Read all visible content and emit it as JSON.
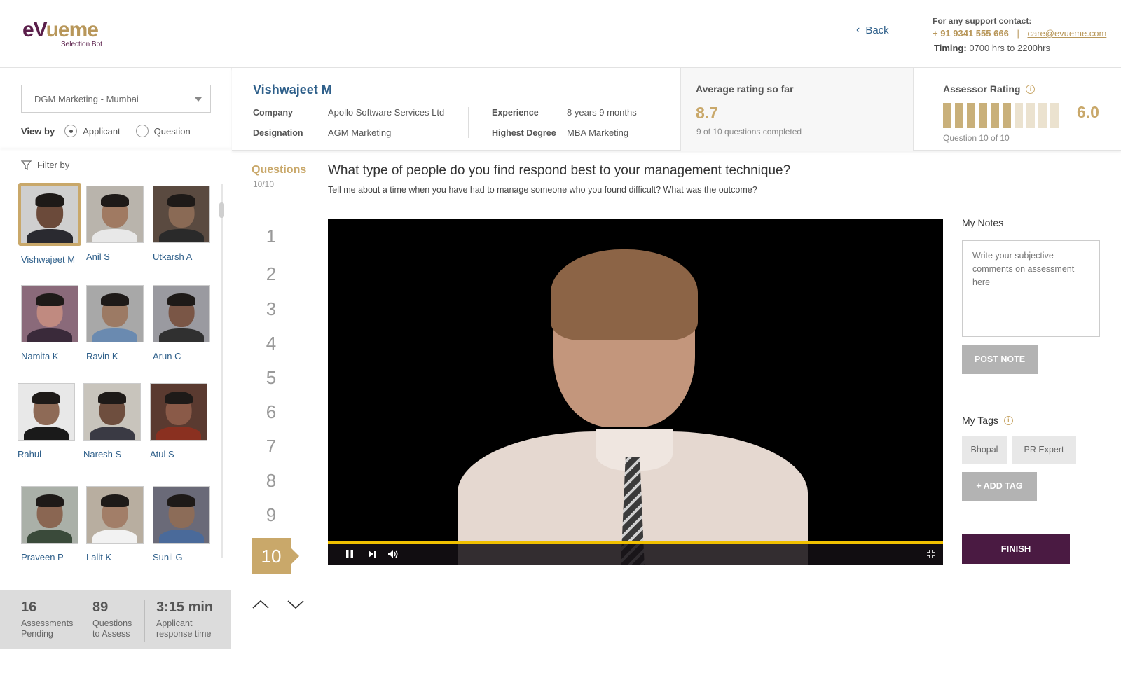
{
  "header": {
    "logo_text_1": "eV",
    "logo_text_2": "ueme",
    "logo_sub": "Selection Bot",
    "back_label": "Back",
    "support_title": "For any support contact:",
    "support_phone": "+ 91 9341 555 666",
    "support_sep": "|",
    "support_email": "care@evueme.com",
    "timing_label": "Timing:",
    "timing_value": "0700 hrs to  2200hrs"
  },
  "left": {
    "select_value": "DGM Marketing - Mumbai",
    "view_by_label": "View by",
    "radio_applicant": "Applicant",
    "radio_question": "Question",
    "filter_label": "Filter by",
    "candidates": [
      {
        "name": "Vishwajeet M",
        "selected": true
      },
      {
        "name": "Anil S"
      },
      {
        "name": "Utkarsh A"
      },
      {
        "name": "Namita K"
      },
      {
        "name": "Ravin K"
      },
      {
        "name": "Arun C"
      },
      {
        "name": "Rahul"
      },
      {
        "name": "Naresh S"
      },
      {
        "name": "Atul S"
      },
      {
        "name": "Praveen P"
      },
      {
        "name": "Lalit K"
      },
      {
        "name": "Sunil G"
      }
    ]
  },
  "stats": [
    {
      "num": "16",
      "l1": "Assessments",
      "l2": "Pending"
    },
    {
      "num": "89",
      "l1": "Questions",
      "l2": "to Assess"
    },
    {
      "num": "3:15 min",
      "l1": "Applicant",
      "l2": "response time"
    }
  ],
  "candidate": {
    "name": "Vishwajeet M",
    "company_label": "Company",
    "company": "Apollo Software Services Ltd",
    "designation_label": "Designation",
    "designation": "AGM Marketing",
    "experience_label": "Experience",
    "experience": "8 years 9 months",
    "degree_label": "Highest Degree",
    "degree": "MBA Marketing"
  },
  "average": {
    "title": "Average rating so far",
    "value": "8.7",
    "sub": "9 of 10 questions completed"
  },
  "assessor": {
    "title": "Assessor Rating",
    "info_icon": "i",
    "value": "6.0",
    "bars_total": 10,
    "bars_filled": 6,
    "sub": "Question 10 of 10"
  },
  "questions": {
    "title": "Questions",
    "count": "10/10",
    "numbers": [
      "1",
      "2",
      "3",
      "4",
      "5",
      "6",
      "7",
      "8",
      "9",
      "10"
    ],
    "active": 10
  },
  "question": {
    "main": "What type of people do you find respond best to your management technique?",
    "sub": "Tell me about a time when you have had to manage someone who you found difficult?  What was the outcome?"
  },
  "video": {
    "progress": 1.0,
    "icons": [
      "pause-icon",
      "skip-next-icon",
      "volume-icon",
      "exit-fullscreen-icon"
    ]
  },
  "notes": {
    "title": "My Notes",
    "placeholder": "Write your subjective comments on assessment here",
    "post_label": "POST NOTE"
  },
  "tags": {
    "title": "My Tags",
    "info_icon": "i",
    "items": [
      "Bhopal",
      "PR Expert"
    ],
    "add_label": "+ ADD TAG"
  },
  "finish_label": "FINISH",
  "colors": {
    "brand_purple": "#4a1a42",
    "brand_gold": "#c9a86a",
    "link_blue": "#2e5f8a"
  }
}
